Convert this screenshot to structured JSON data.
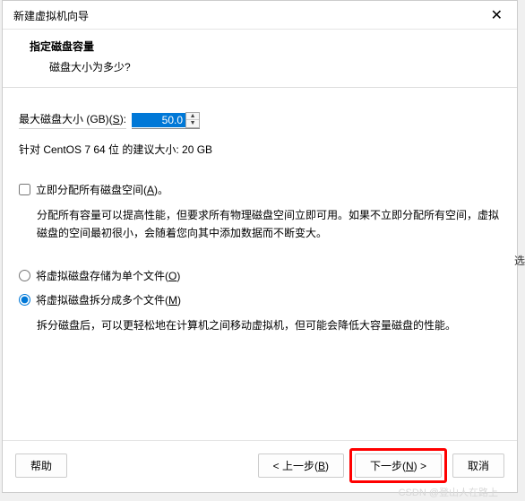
{
  "titlebar": {
    "title": "新建虚拟机向导"
  },
  "header": {
    "title": "指定磁盘容量",
    "subtitle": "磁盘大小为多少?"
  },
  "disk_size": {
    "label_prefix": "最大磁盘大小 (GB)(",
    "label_accel": "S",
    "label_suffix": "):",
    "value": "50.0"
  },
  "suggestion": "针对 CentOS 7 64 位 的建议大小: 20 GB",
  "allocate_now": {
    "label_prefix": "立即分配所有磁盘空间(",
    "label_accel": "A",
    "label_suffix": ")。",
    "desc": "分配所有容量可以提高性能，但要求所有物理磁盘空间立即可用。如果不立即分配所有空间，虚拟磁盘的空间最初很小，会随着您向其中添加数据而不断变大。"
  },
  "radio": {
    "single": {
      "label_prefix": "将虚拟磁盘存储为单个文件(",
      "label_accel": "O",
      "label_suffix": ")"
    },
    "split": {
      "label_prefix": "将虚拟磁盘拆分成多个文件(",
      "label_accel": "M",
      "label_suffix": ")",
      "desc": "拆分磁盘后，可以更轻松地在计算机之间移动虚拟机，但可能会降低大容量磁盘的性能。"
    }
  },
  "footer": {
    "help": "帮助",
    "back_prefix": "< 上一步(",
    "back_accel": "B",
    "back_suffix": ")",
    "next_prefix": "下一步(",
    "next_accel": "N",
    "next_suffix": ") >",
    "cancel": "取消"
  },
  "watermark": "CSDN @登山人在路上",
  "side_char": "选"
}
